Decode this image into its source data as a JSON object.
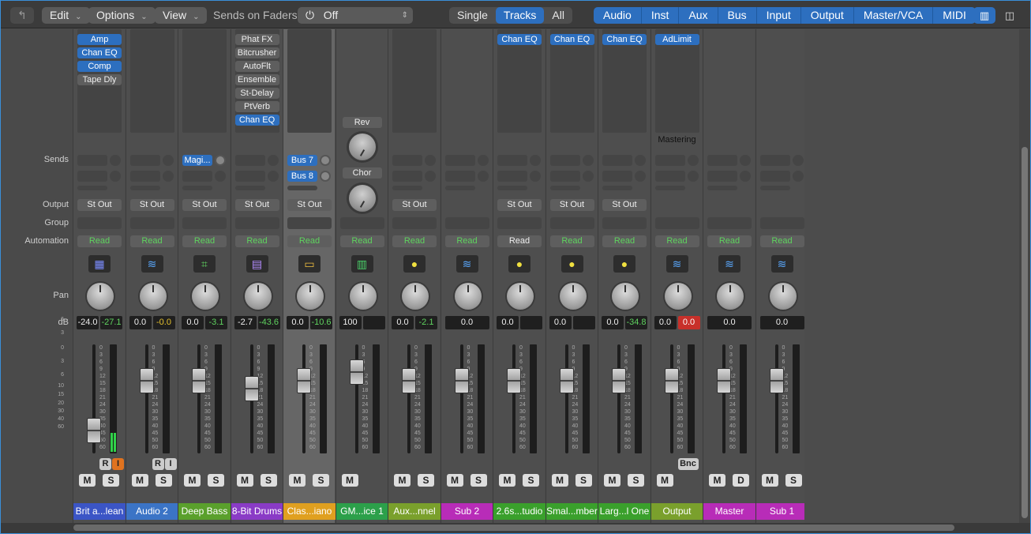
{
  "toolbar": {
    "back_icon": "↰",
    "edit": "Edit",
    "options": "Options",
    "view": "View",
    "sends_label": "Sends on Faders:",
    "sends_value": "Off",
    "power_icon": "⏻",
    "single": "Single",
    "tracks": "Tracks",
    "all": "All",
    "filters": [
      "Audio",
      "Inst",
      "Aux",
      "Bus",
      "Input",
      "Output",
      "Master/VCA",
      "MIDI"
    ],
    "view_icon_1": "▥",
    "view_icon_2": "◫"
  },
  "row_labels": {
    "sends": "Sends",
    "output": "Output",
    "group": "Group",
    "automation": "Automation",
    "pan": "Pan",
    "db": "dB"
  },
  "scale_ticks": [
    "6",
    "3",
    "0",
    "3",
    "6",
    "10",
    "15",
    "20",
    "30",
    "40",
    "60"
  ],
  "strip_scale": [
    "0",
    "3",
    "6",
    "9",
    "12",
    "15",
    "18",
    "21",
    "24",
    "30",
    "35",
    "40",
    "45",
    "50",
    "60"
  ],
  "strips": [
    {
      "name": "Brit a...lean",
      "color": "#3b55c6",
      "inserts": [
        "Amp",
        "Chan EQ",
        "Comp",
        "Tape Dly"
      ],
      "insert_blue": [
        true,
        true,
        true,
        false
      ],
      "output": "St Out",
      "automation": "Read",
      "icon": "▦",
      "icon_color": "#7b8cff",
      "db1": "-24.0",
      "db2": "-27.1",
      "db2_style": "g",
      "fader": 0.12,
      "meter": 0.18,
      "ri": true,
      "r_orange": false,
      "i_orange": true,
      "mute": "M",
      "solo": "S"
    },
    {
      "name": "Audio 2",
      "color": "#3b74c6",
      "inserts": [],
      "output": "St Out",
      "automation": "Read",
      "icon": "≋",
      "icon_color": "#5aa9ff",
      "db1": "0.0",
      "db2": "-0.0",
      "db2_style": "y",
      "fader": 0.72,
      "meter": 0,
      "ri": true,
      "mute": "M",
      "solo": "S"
    },
    {
      "name": "Deep Bass",
      "color": "#5aa02c",
      "inserts": [],
      "output": "St Out",
      "automation": "Read",
      "icon": "⌗",
      "icon_color": "#5fd35f",
      "db1": "0.0",
      "db2": "-3.1",
      "db2_style": "g",
      "fader": 0.72,
      "meter": 0,
      "send": "Magi...",
      "mute": "M",
      "solo": "S"
    },
    {
      "name": "8-Bit Drums",
      "color": "#8a3bc6",
      "inserts": [
        "Phat FX",
        "Bitcrusher",
        "AutoFlt",
        "Ensemble",
        "St-Delay",
        "PtVerb",
        "Chan EQ"
      ],
      "insert_blue": [
        false,
        false,
        false,
        false,
        false,
        false,
        true
      ],
      "output": "St Out",
      "automation": "Read",
      "icon": "▤",
      "icon_color": "#b48cff",
      "db1": "-2.7",
      "db2": "-43.6",
      "db2_style": "g",
      "fader": 0.62,
      "meter": 0,
      "mute": "M",
      "solo": "S"
    },
    {
      "name": "Clas...iano",
      "color": "#e0a020",
      "inserts": [],
      "output": "St Out",
      "automation": "Read",
      "icon": "▭",
      "icon_color": "#f0c040",
      "db1": "0.0",
      "db2": "-10.6",
      "db2_style": "g",
      "fader": 0.72,
      "meter": 0,
      "sends": [
        "Bus 7",
        "Bus 8"
      ],
      "selected": true,
      "mute": "M",
      "solo": "S"
    },
    {
      "name": "GM...ice 1",
      "color": "#2ca04a",
      "output": "",
      "automation": "Read",
      "icon": "▥",
      "icon_color": "#4ad36a",
      "db1": "100",
      "db2": "",
      "fader": 0.82,
      "aux_plugins": [
        "Rev",
        "Chor"
      ],
      "mute": "M",
      "solo": ""
    },
    {
      "name": "Aux...nnel",
      "color": "#7aa02c",
      "inserts": [],
      "output": "St Out",
      "automation": "Read",
      "icon": "●",
      "icon_color": "#f0e040",
      "db1": "0.0",
      "db2": "-2.1",
      "db2_style": "g",
      "fader": 0.72,
      "meter": 0,
      "mute": "M",
      "solo": "S"
    },
    {
      "name": "Sub 2",
      "color": "#b82cb8",
      "output": "",
      "automation": "Read",
      "icon": "≋",
      "icon_color": "#5aa9ff",
      "db1": "0.0",
      "db2": null,
      "fader": 0.72,
      "mute": "M",
      "solo": "S"
    },
    {
      "name": "2.6s...tudio",
      "color": "#3aa02c",
      "inserts": [
        "Chan EQ"
      ],
      "insert_blue": [
        true
      ],
      "output": "St Out",
      "automation": "Read",
      "auto_white": true,
      "icon": "●",
      "icon_color": "#f0e040",
      "db1": "0.0",
      "db2": "",
      "fader": 0.72,
      "mute": "M",
      "solo": "S"
    },
    {
      "name": "Smal...mber",
      "color": "#3aa02c",
      "inserts": [
        "Chan EQ"
      ],
      "insert_blue": [
        true
      ],
      "output": "St Out",
      "automation": "Read",
      "icon": "●",
      "icon_color": "#f0e040",
      "db1": "0.0",
      "db2": "",
      "fader": 0.72,
      "mute": "M",
      "solo": "S"
    },
    {
      "name": "Larg...l One",
      "color": "#3aa02c",
      "inserts": [
        "Chan EQ"
      ],
      "insert_blue": [
        true
      ],
      "output": "St Out",
      "automation": "Read",
      "icon": "●",
      "icon_color": "#f0e040",
      "db1": "0.0",
      "db2": "-34.8",
      "db2_style": "g",
      "fader": 0.72,
      "mute": "M",
      "solo": "S"
    },
    {
      "name": "Output",
      "color": "#7aa02c",
      "inserts": [
        "AdLimit"
      ],
      "insert_blue": [
        true
      ],
      "inserts_label": "Mastering",
      "output": "",
      "automation": "Read",
      "icon": "≋",
      "icon_color": "#5aa9ff",
      "db1": "0.0",
      "db2": "0.0",
      "db2_style": "r",
      "fader": 0.72,
      "bnc": "Bnc",
      "mute": "M",
      "solo": ""
    },
    {
      "name": "Master",
      "color": "#b82cb8",
      "output": "",
      "automation": "Read",
      "icon": "≋",
      "icon_color": "#5aa9ff",
      "db1": "0.0",
      "db2": null,
      "fader": 0.72,
      "mute": "M",
      "solo": "D"
    },
    {
      "name": "Sub 1",
      "color": "#b82cb8",
      "output": "",
      "automation": "Read",
      "icon": "≋",
      "icon_color": "#5aa9ff",
      "db1": "0.0",
      "db2": null,
      "fader": 0.72,
      "mute": "M",
      "solo": "S"
    }
  ]
}
